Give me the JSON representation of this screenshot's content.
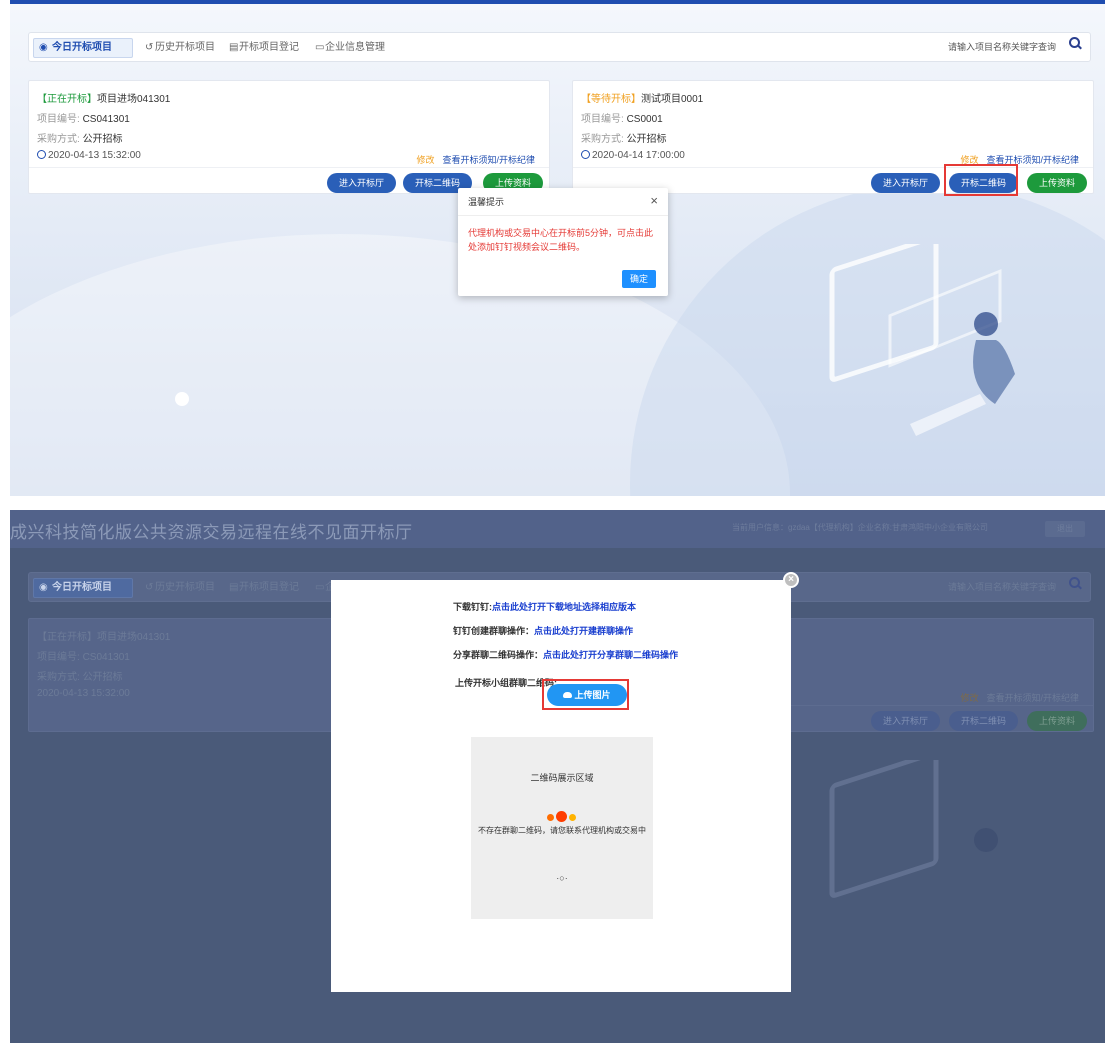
{
  "tabs": [
    {
      "label": "今日开标项目",
      "icon": "today-icon",
      "glyph": "◉"
    },
    {
      "label": "历史开标项目",
      "icon": "history-icon",
      "glyph": "↺"
    },
    {
      "label": "开标项目登记",
      "icon": "register-icon",
      "glyph": "▤"
    },
    {
      "label": "企业信息管理",
      "icon": "monitor-icon",
      "glyph": "▭"
    }
  ],
  "search": {
    "placeholder": "请输入项目名称关键字查询"
  },
  "cards": [
    {
      "status": "【正在开标】",
      "name": "项目进场041301",
      "code_label": "项目编号:",
      "code": "CS041301",
      "method_label": "采购方式:",
      "method": "公开招标",
      "time": "2020-04-13 15:32:00",
      "edit": "修改",
      "view": "查看开标须知/开标纪律",
      "btn_enter": "进入开标厅",
      "btn_qr": "开标二维码",
      "btn_upload": "上传资料"
    },
    {
      "status": "【等待开标】",
      "name": "测试项目0001",
      "code_label": "项目编号:",
      "code": "CS0001",
      "method_label": "采购方式:",
      "method": "公开招标",
      "time": "2020-04-14 17:00:00",
      "edit": "修改",
      "view": "查看开标须知/开标纪律",
      "btn_enter": "进入开标厅",
      "btn_qr": "开标二维码",
      "btn_upload": "上传资料"
    }
  ],
  "dialog": {
    "title": "温馨提示",
    "close": "×",
    "body": "代理机构或交易中心在开标前5分钟，可点击此处添加钉钉视频会议二维码。",
    "ok": "确定"
  },
  "header": {
    "app_title": "成兴科技简化版公共资源交易远程在线不见面开标厅",
    "user_info": "当前用户信息：gzdaa【代理机构】企业名称:甘肃鸿阳中小企业有限公司",
    "logout": "退出"
  },
  "modal": {
    "close": "×",
    "row1_label": "下载钉钉:",
    "row1_link": "点击此处打开下载地址选择相应版本",
    "row2_label": "钉钉创建群聊操作：",
    "row2_link": "点击此处打开建群聊操作",
    "row3_label": "分享群聊二维码操作：",
    "row3_link": "点击此处打开分享群聊二维码操作",
    "upload_label": "上传开标小组群聊二维码:",
    "upload_btn": "上传图片",
    "qr_title": "二维码展示区域",
    "qr_message": "不存在群聊二维码，请您联系代理机构或交易中",
    "spinner": "·○·",
    "dot_colors": [
      "#ff6d00",
      "#ff3d00",
      "#ffb300"
    ]
  },
  "colors": {
    "accent": "#1f4db0",
    "highlight": "#e53935",
    "green": "#1d9a3c"
  }
}
